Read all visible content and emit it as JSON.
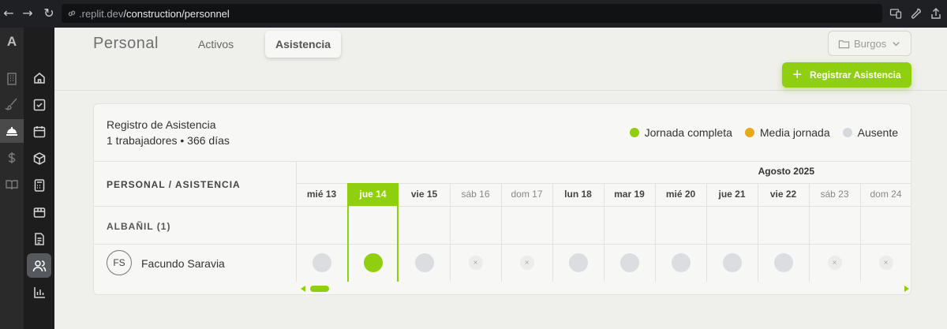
{
  "browser": {
    "url_domain": ".replit.dev",
    "url_path": "/construction/personnel"
  },
  "rail": {
    "logo": "A",
    "icons": [
      "building-icon",
      "brush-icon",
      "hardhat-icon",
      "dollar-icon",
      "book-icon"
    ],
    "active": "hardhat-icon"
  },
  "sidebar": {
    "icons": [
      "home-icon",
      "checkbox-icon",
      "calendar-icon",
      "box-icon",
      "calculator-icon",
      "package-icon",
      "document-icon",
      "users-icon",
      "chart-icon"
    ],
    "active": "users-icon"
  },
  "header": {
    "title": "Personal",
    "tabs": [
      {
        "label": "Activos",
        "active": false
      },
      {
        "label": "Asistencia",
        "active": true
      }
    ],
    "location": "Burgos",
    "register_button": "Registrar Asistencia"
  },
  "card": {
    "title": "Registro de Asistencia",
    "subtitle": "1 trabajadores • 366 días",
    "legend": [
      {
        "label": "Jornada completa",
        "color": "#8fcf0d"
      },
      {
        "label": "Media jornada",
        "color": "#e9a81c"
      },
      {
        "label": "Ausente",
        "color": "#d6d8dc"
      }
    ],
    "left_header": "PERSONAL / ASISTENCIA",
    "month": "Agosto 2025",
    "days": [
      {
        "label": "mié 13",
        "weekend": false,
        "today": false
      },
      {
        "label": "jue 14",
        "weekend": false,
        "today": true
      },
      {
        "label": "vie 15",
        "weekend": false,
        "today": false
      },
      {
        "label": "sáb 16",
        "weekend": true,
        "today": false
      },
      {
        "label": "dom 17",
        "weekend": true,
        "today": false
      },
      {
        "label": "lun 18",
        "weekend": false,
        "today": false
      },
      {
        "label": "mar 19",
        "weekend": false,
        "today": false
      },
      {
        "label": "mié 20",
        "weekend": false,
        "today": false
      },
      {
        "label": "jue 21",
        "weekend": false,
        "today": false
      },
      {
        "label": "vie 22",
        "weekend": false,
        "today": false
      },
      {
        "label": "sáb 23",
        "weekend": true,
        "today": false
      },
      {
        "label": "dom 24",
        "weekend": true,
        "today": false
      }
    ],
    "group": "ALBAÑIL (1)",
    "worker": {
      "initials": "FS",
      "name": "Facundo Saravia",
      "attendance": [
        "absent",
        "full",
        "absent",
        "off",
        "off",
        "absent",
        "absent",
        "absent",
        "absent",
        "absent",
        "off",
        "off"
      ]
    },
    "off_mark": "×"
  }
}
